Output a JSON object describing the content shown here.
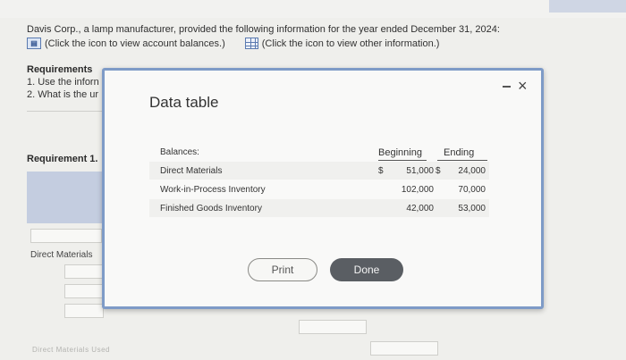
{
  "intro": {
    "text": "Davis Corp., a lamp manufacturer, provided the following information for the year ended December 31, 2024:",
    "icon1_label": "(Click the icon to view account balances.)",
    "icon2_label": "(Click the icon to view other information.)"
  },
  "requirements": {
    "heading": "Requirements",
    "line1": "1. Use the inforn",
    "line2": "2. What is the ur",
    "req1_label": "Requirement 1.",
    "dm_label": "Direct Materials",
    "faded": "Direct Materials Used"
  },
  "modal": {
    "title": "Data table",
    "balances_label": "Balances:",
    "col_beginning": "Beginning",
    "col_ending": "Ending",
    "rows": [
      {
        "label": "Direct Materials",
        "dollar1": "$",
        "beginning": "51,000",
        "dollar2": "$",
        "ending": "24,000"
      },
      {
        "label": "Work-in-Process Inventory",
        "beginning": "102,000",
        "ending": "70,000"
      },
      {
        "label": "Finished Goods Inventory",
        "beginning": "42,000",
        "ending": "53,000"
      }
    ],
    "print_label": "Print",
    "done_label": "Done"
  }
}
